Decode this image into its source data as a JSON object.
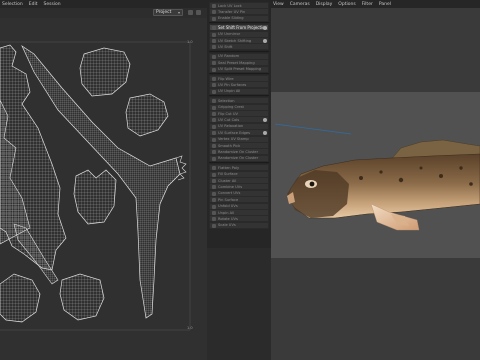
{
  "uv_editor": {
    "menu": [
      "Selection",
      "Edit",
      "Session"
    ],
    "project_dropdown": "Project",
    "axis_labels": {
      "top_right": "1.0",
      "bottom_right": "1.0"
    }
  },
  "operation_menu": {
    "items": [
      {
        "label": "Lock UV Lock",
        "active": false
      },
      {
        "label": "Transfer UV Pin",
        "active": false
      },
      {
        "label": "Enable Sliding",
        "active": false
      },
      {
        "label": "",
        "separator": true
      },
      {
        "label": "Set Shift From Projection",
        "active": true,
        "dot": true
      },
      {
        "label": "UV Unmirror",
        "active": false
      },
      {
        "label": "UV Sketch Shifting",
        "active": false,
        "dot": true
      },
      {
        "label": "UV Shift",
        "active": false
      },
      {
        "label": "",
        "separator": true
      },
      {
        "label": "UV Random",
        "active": false
      },
      {
        "label": "Seal Preset Mapping",
        "active": false
      },
      {
        "label": "UV Split Preset Mapping",
        "active": false
      },
      {
        "label": "",
        "separator": true
      },
      {
        "label": "Flip Wire",
        "active": false
      },
      {
        "label": "UV Pin Surfaces",
        "active": false
      },
      {
        "label": "UV Unpin All",
        "active": false
      },
      {
        "label": "",
        "separator": true
      },
      {
        "label": "Selection",
        "active": false
      },
      {
        "label": "Gripping Crest",
        "active": false
      },
      {
        "label": "Flip Cut UV",
        "active": false
      },
      {
        "label": "UV Cut Cols",
        "active": false,
        "dot": true
      },
      {
        "label": "UV Relaxation",
        "active": false
      },
      {
        "label": "UV Surface Edges",
        "active": false,
        "dot": true
      },
      {
        "label": "Vertex UV Stamp",
        "active": false
      },
      {
        "label": "Smooth Pick",
        "active": false
      },
      {
        "label": "Randomize On Cluster",
        "active": false
      },
      {
        "label": "Randomize On Cluster",
        "active": false
      },
      {
        "label": "",
        "separator": true
      },
      {
        "label": "Flatten Poly",
        "active": false
      },
      {
        "label": "Fill Surface",
        "active": false
      },
      {
        "label": "Cluster All",
        "active": false
      },
      {
        "label": "Combine UVs",
        "active": false
      },
      {
        "label": "Convert UVs",
        "active": false
      },
      {
        "label": "Pin Surface",
        "active": false
      },
      {
        "label": "Unfold UVs",
        "active": false
      },
      {
        "label": "Unpin All",
        "active": false
      },
      {
        "label": "Rotate UVs",
        "active": false
      },
      {
        "label": "Scale UVs",
        "active": false
      }
    ]
  },
  "viewport": {
    "menu": [
      "View",
      "Cameras",
      "Display",
      "Options",
      "Filter",
      "Panel"
    ]
  },
  "colors": {
    "uv_background": "#303030",
    "uv_wireframe": "#cfcfcf",
    "viewport_background": "#515151",
    "fish_body": "#7a5a3c",
    "fish_belly": "#d8b28a"
  }
}
